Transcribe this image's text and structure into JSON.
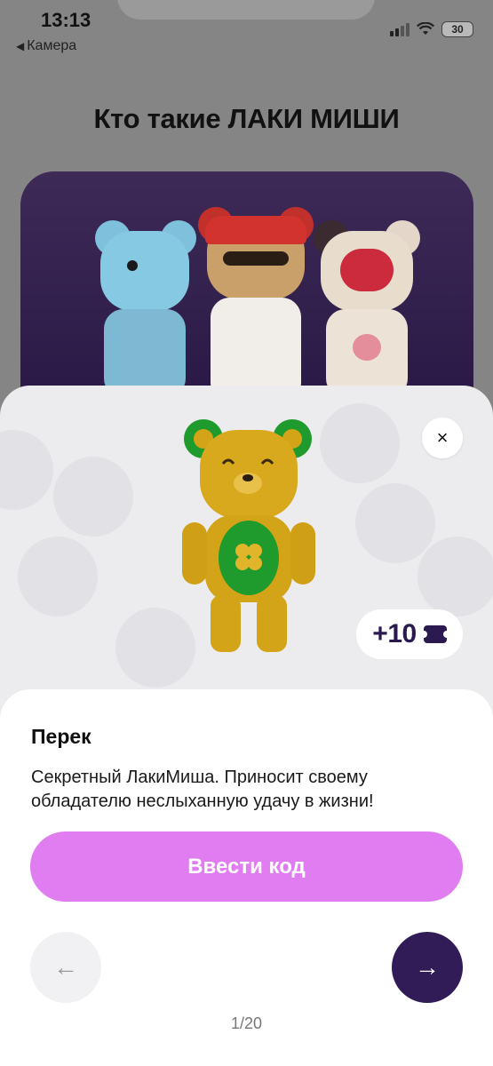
{
  "status_bar": {
    "time": "13:13",
    "back_label": "Камера",
    "battery": "30"
  },
  "background": {
    "heading": "Кто такие ЛАКИ МИШИ"
  },
  "modal": {
    "close_symbol": "×",
    "points_badge": "+10",
    "points_icon": "ticket-icon",
    "title": "Перек",
    "description": "Секретный ЛакиМиша. Приносит своему обладателю неслыханную удачу в жизни!",
    "cta_label": "Ввести код",
    "prev_symbol": "←",
    "next_symbol": "→",
    "pager": "1/20"
  },
  "colors": {
    "accent_pink": "#e07df0",
    "deep_purple": "#311c58",
    "bear_gold": "#d4a418",
    "bear_green": "#1f9a2c"
  }
}
